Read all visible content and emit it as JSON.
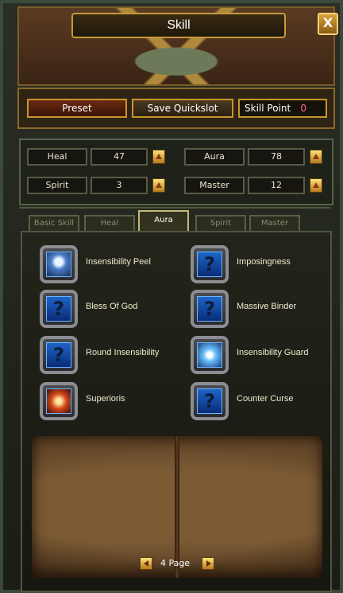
{
  "window": {
    "title": "Skill",
    "close_label": "X"
  },
  "toolbar": {
    "preset_label": "Preset",
    "save_quickslot_label": "Save Quickslot",
    "skill_point_label": "Skill Point",
    "skill_point_value": "0"
  },
  "stats": [
    {
      "label": "Heal",
      "value": "47"
    },
    {
      "label": "Aura",
      "value": "78"
    },
    {
      "label": "Spirit",
      "value": "3"
    },
    {
      "label": "Master",
      "value": "12"
    }
  ],
  "tabs": [
    {
      "label": "Basic Skill"
    },
    {
      "label": "Heal"
    },
    {
      "label": "Aura"
    },
    {
      "label": "Spirit"
    },
    {
      "label": "Master"
    }
  ],
  "active_tab": "Aura",
  "skills": [
    {
      "name": "Insensibility Peel",
      "icon": "insensibility-peel-icon"
    },
    {
      "name": "Imposingness",
      "icon": "question-mark-icon"
    },
    {
      "name": "Bless Of God",
      "icon": "question-mark-icon"
    },
    {
      "name": "Massive Binder",
      "icon": "question-mark-icon"
    },
    {
      "name": "Round Insensibility",
      "icon": "question-mark-icon"
    },
    {
      "name": "Insensibility Guard",
      "icon": "insensibility-guard-icon"
    },
    {
      "name": "Superioris",
      "icon": "superioris-icon"
    },
    {
      "name": "Counter Curse",
      "icon": "question-mark-icon"
    }
  ],
  "unknown_icon_glyph": "?",
  "pagination": {
    "page_text": "4 Page"
  }
}
